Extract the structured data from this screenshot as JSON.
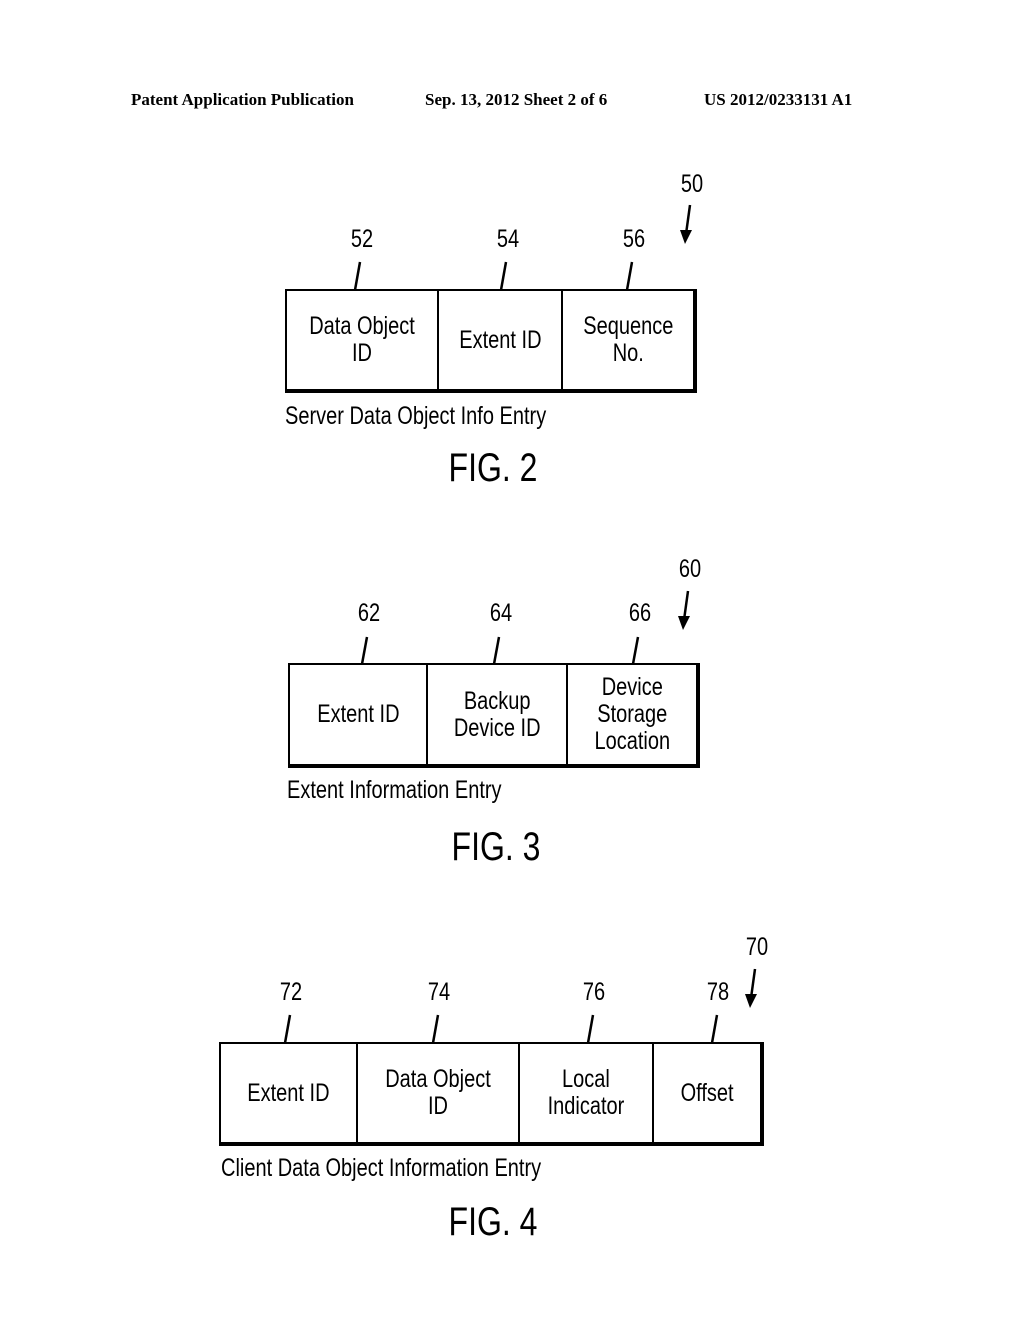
{
  "header": {
    "publication": "Patent Application Publication",
    "date_sheet": "Sep. 13, 2012   Sheet 2 of 6",
    "number": "US 2012/0233131 A1"
  },
  "figures": [
    {
      "figure_label": "FIG. 2",
      "ref": "50",
      "caption": "Server Data Object Info Entry",
      "fields": [
        {
          "ref": "52",
          "label": "Data Object\nID"
        },
        {
          "ref": "54",
          "label": "Extent ID"
        },
        {
          "ref": "56",
          "label": "Sequence\nNo."
        }
      ]
    },
    {
      "figure_label": "FIG. 3",
      "ref": "60",
      "caption": "Extent Information Entry",
      "fields": [
        {
          "ref": "62",
          "label": "Extent ID"
        },
        {
          "ref": "64",
          "label": "Backup\nDevice ID"
        },
        {
          "ref": "66",
          "label": "Device\nStorage\nLocation"
        }
      ]
    },
    {
      "figure_label": "FIG. 4",
      "ref": "70",
      "caption": "Client Data Object Information Entry",
      "fields": [
        {
          "ref": "72",
          "label": "Extent ID"
        },
        {
          "ref": "74",
          "label": "Data Object\nID"
        },
        {
          "ref": "76",
          "label": "Local\nIndicator"
        },
        {
          "ref": "78",
          "label": "Offset"
        }
      ]
    }
  ]
}
